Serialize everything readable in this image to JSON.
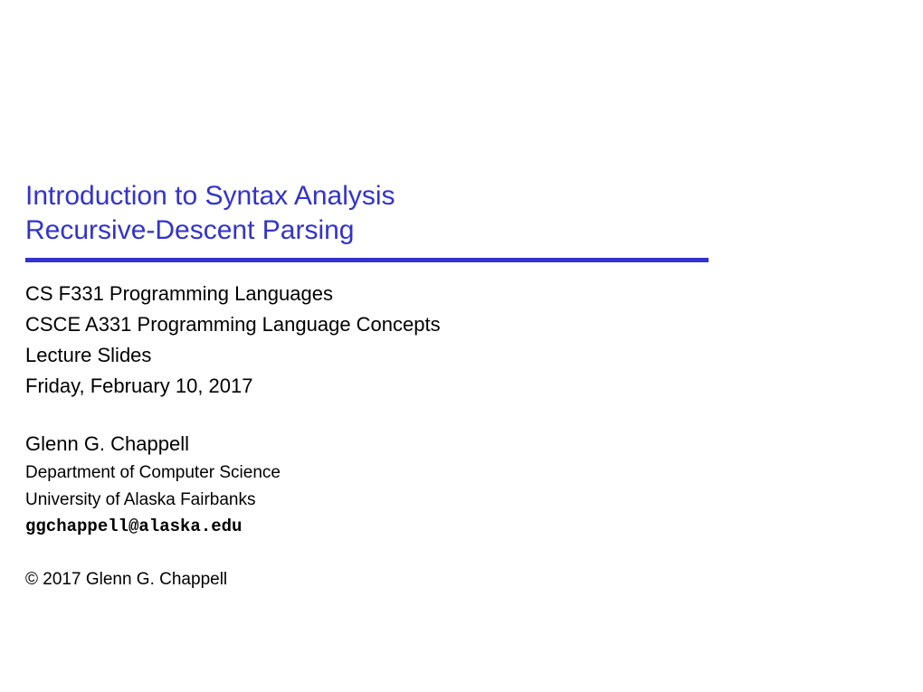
{
  "title": {
    "line1": "Introduction to Syntax Analysis",
    "line2": "Recursive-Descent Parsing"
  },
  "course": {
    "line1": "CS F331 Programming Languages",
    "line2": "CSCE A331 Programming Language Concepts",
    "line3": "Lecture Slides",
    "date": "Friday, February 10, 2017"
  },
  "author": {
    "name": "Glenn G. Chappell",
    "dept": "Department of Computer Science",
    "university": "University of Alaska Fairbanks",
    "email": "ggchappell@alaska.edu"
  },
  "copyright": "© 2017 Glenn G. Chappell"
}
